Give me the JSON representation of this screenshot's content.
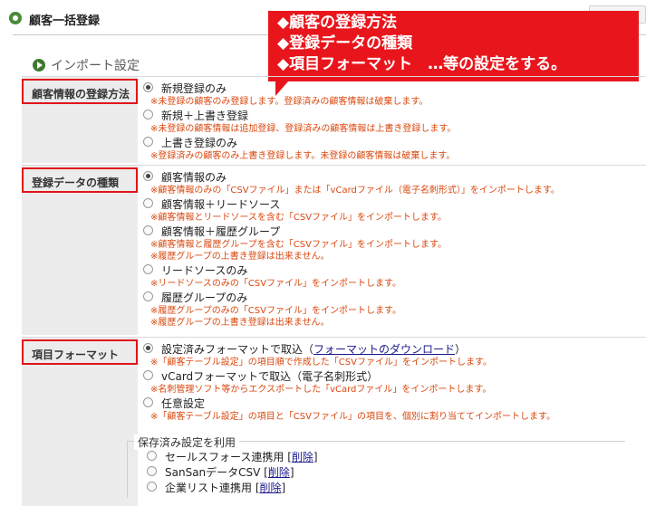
{
  "page": {
    "title": "顧客一括登録",
    "section_title": "インポート設定"
  },
  "callout": {
    "line1": "◆顧客の登録方法",
    "line2": "◆登録データの種類",
    "line3": "◆項目フォーマット　…等の設定をする。"
  },
  "registration_method": {
    "label": "顧客情報の登録方法",
    "options": [
      {
        "label": "新規登録のみ",
        "checked": true,
        "note": "※未登録の顧客のみ登録します。登録済みの顧客情報は破棄します。"
      },
      {
        "label": "新規＋上書き登録",
        "checked": false,
        "note": "※未登録の顧客情報は追加登録、登録済みの顧客情報は上書き登録します。"
      },
      {
        "label": "上書き登録のみ",
        "checked": false,
        "note": "※登録済みの顧客のみ上書き登録します。未登録の顧客情報は破棄します。"
      }
    ]
  },
  "data_type": {
    "label": "登録データの種類",
    "options": [
      {
        "label": "顧客情報のみ",
        "checked": true,
        "note1": "※顧客情報のみの「CSVファイル」または「vCardファイル（電子名刺形式）」をインポートします。",
        "note2": ""
      },
      {
        "label": "顧客情報＋リードソース",
        "checked": false,
        "note1": "※顧客情報とリードソースを含む「CSVファイル」をインポートします。",
        "note2": ""
      },
      {
        "label": "顧客情報＋履歴グループ",
        "checked": false,
        "note1": "※顧客情報と履歴グループを含む「CSVファイル」をインポートします。",
        "note2": "※履歴グループの上書き登録は出来ません。"
      },
      {
        "label": "リードソースのみ",
        "checked": false,
        "note1": "※リードソースのみの「CSVファイル」をインポートします。",
        "note2": ""
      },
      {
        "label": "履歴グループのみ",
        "checked": false,
        "note1": "※履歴グループのみの「CSVファイル」をインポートします。",
        "note2": "※履歴グループの上書き登録は出来ません。"
      }
    ]
  },
  "item_format": {
    "label": "項目フォーマット",
    "options": [
      {
        "label_prefix": "設定済みフォーマットで取込（",
        "link": "フォーマットのダウンロード",
        "label_suffix": "）",
        "checked": true,
        "note": "※「顧客テーブル設定」の項目順で作成した「CSVファイル」をインポートします。"
      },
      {
        "label": "vCardフォーマットで取込（電子名刺形式）",
        "checked": false,
        "note": "※名刺管理ソフト等からエクスポートした「vCardファイル」をインポートします。"
      },
      {
        "label": "任意設定",
        "checked": false,
        "note": "※「顧客テーブル設定」の項目と「CSVファイル」の項目を、個別に割り当ててインポートします。"
      }
    ]
  },
  "saved_settings": {
    "legend": "保存済み設定を利用",
    "delete_label": "削除",
    "items": [
      {
        "name": "セールスフォース連携用"
      },
      {
        "name": "SanSanデータCSV"
      },
      {
        "name": "企業リスト連携用"
      }
    ]
  }
}
